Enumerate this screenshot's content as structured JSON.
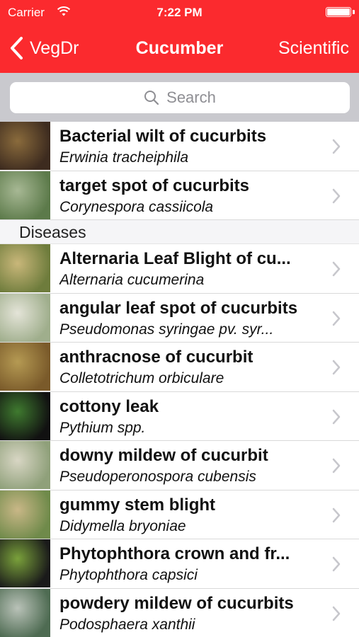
{
  "status": {
    "carrier": "Carrier",
    "time": "7:22 PM"
  },
  "nav": {
    "back_label": "VegDr",
    "title": "Cucumber",
    "right_label": "Scientific"
  },
  "search": {
    "placeholder": "Search"
  },
  "colors": {
    "accent": "#fb2a2e",
    "search_bg": "#c9c9ce"
  },
  "top_items": [
    {
      "name": "Bacterial wilt of cucurbits",
      "scientific": "Erwinia tracheiphila",
      "thumb": [
        "#3d2b1f",
        "#8a6b3c"
      ]
    },
    {
      "name": "target spot of cucurbits",
      "scientific": "Corynespora cassiicola",
      "thumb": [
        "#5c7a4a",
        "#a7b894"
      ]
    }
  ],
  "section": {
    "label": "Diseases"
  },
  "disease_items": [
    {
      "name": "Alternaria Leaf Blight of cu...",
      "scientific": "Alternaria cucumerina",
      "thumb": [
        "#6e7c3c",
        "#c9b77a"
      ]
    },
    {
      "name": "angular leaf spot of cucurbits",
      "scientific": "Pseudomonas syringae pv. syr...",
      "thumb": [
        "#9fae8c",
        "#e4e4d8"
      ]
    },
    {
      "name": "anthracnose of cucurbit",
      "scientific": "Colletotrichum orbiculare",
      "thumb": [
        "#7a5a2a",
        "#b59a53"
      ]
    },
    {
      "name": "cottony leak",
      "scientific": "Pythium spp.",
      "thumb": [
        "#111111",
        "#3f7a2f"
      ]
    },
    {
      "name": "downy mildew of cucurbit",
      "scientific": "Pseudoperonospora cubensis",
      "thumb": [
        "#8fa07a",
        "#d8d6c4"
      ]
    },
    {
      "name": "gummy stem blight",
      "scientific": "Didymella bryoniae",
      "thumb": [
        "#6f8a4a",
        "#c9b787"
      ]
    },
    {
      "name": "Phytophthora crown and fr...",
      "scientific": "Phytophthora capsici",
      "thumb": [
        "#1a1a1a",
        "#7aa13b"
      ]
    },
    {
      "name": "powdery mildew of cucurbits",
      "scientific": "Podosphaera xanthii",
      "thumb": [
        "#4e6b52",
        "#b9c2b8"
      ]
    }
  ]
}
